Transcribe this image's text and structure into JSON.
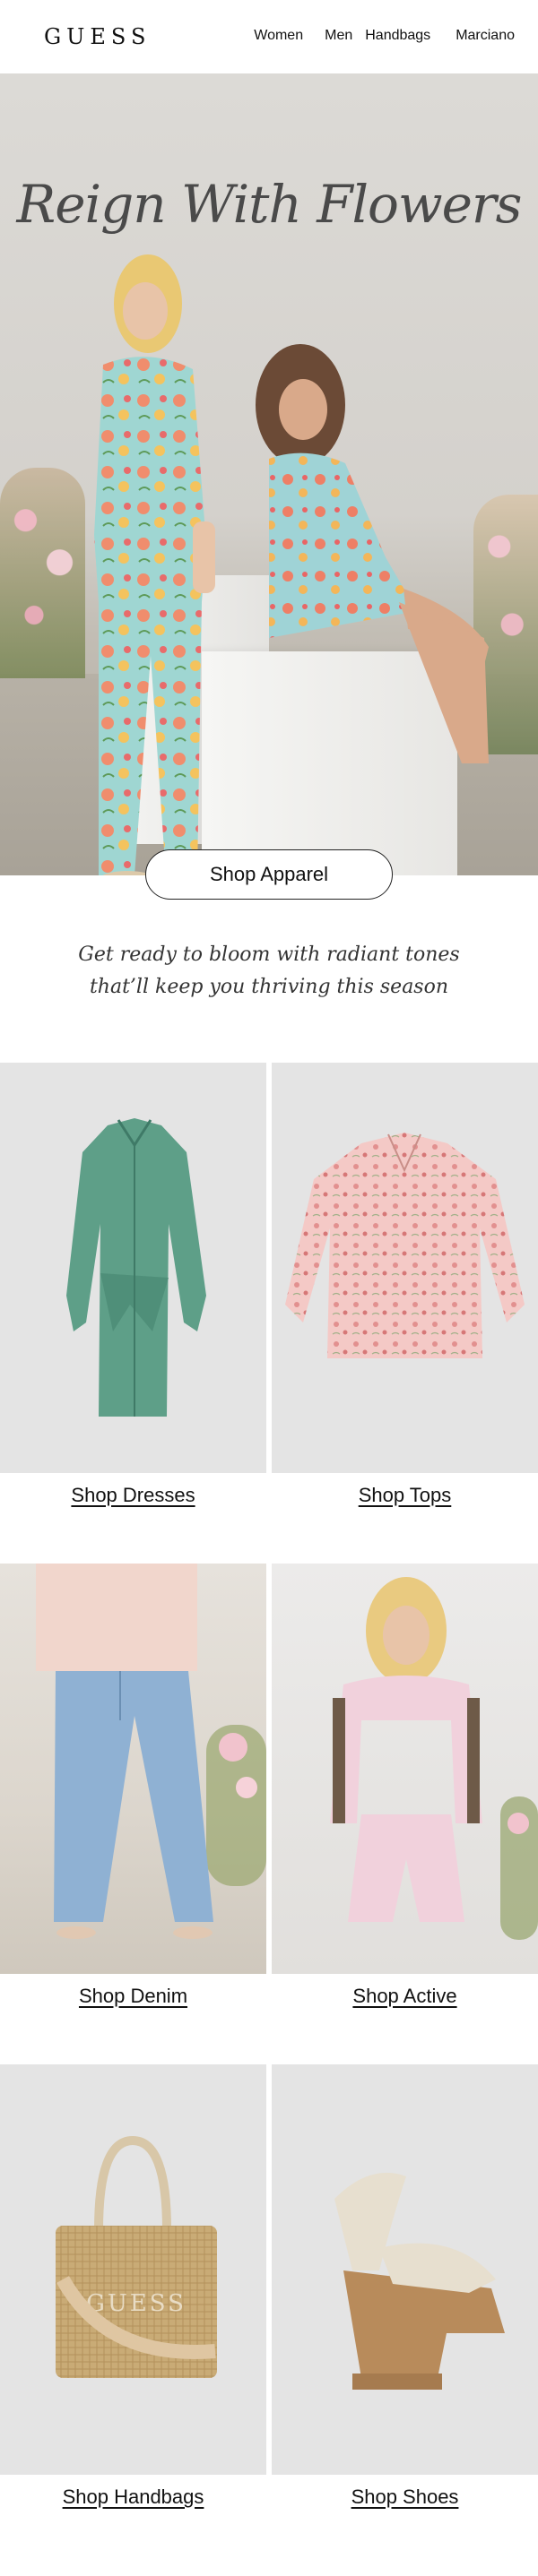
{
  "brand": {
    "logo_text": "GUESS"
  },
  "nav": {
    "items": [
      "Women",
      "Men",
      "Handbags",
      "Marciano"
    ]
  },
  "hero": {
    "title": "Reign With Flowers",
    "cta_label": "Shop Apparel"
  },
  "tagline": {
    "line1": "Get ready to bloom with radiant tones",
    "line2": "that’ll keep you thriving this season"
  },
  "categories": [
    {
      "label": "Shop Dresses"
    },
    {
      "label": "Shop Tops"
    },
    {
      "label": "Shop Denim"
    },
    {
      "label": "Shop Active"
    },
    {
      "label": "Shop Handbags"
    },
    {
      "label": "Shop Shoes"
    }
  ],
  "handbag_logo_text": "GUESS",
  "colors": {
    "dress": "#5e9f88",
    "top": "#f4c9c6",
    "denim": "#8fb1d3",
    "active": "#f1d1dc",
    "handbag": "#c9ab76",
    "shoe": "#b88b5b"
  }
}
